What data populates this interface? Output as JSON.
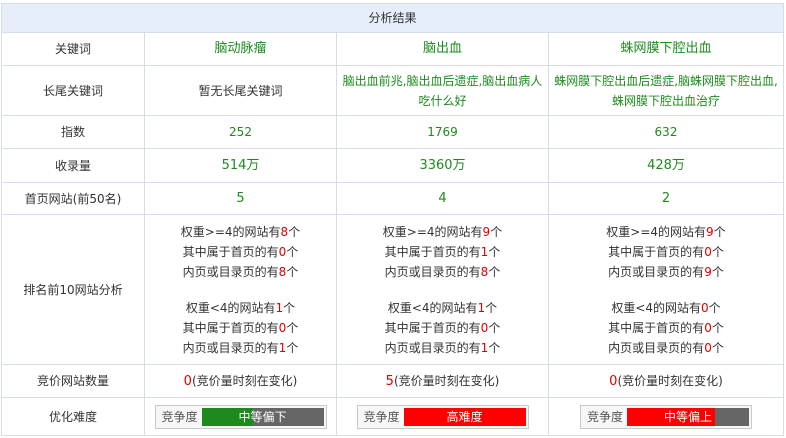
{
  "title": "分析结果",
  "rows": {
    "keyword": {
      "label": "关键词",
      "values": [
        "脑动脉瘤",
        "脑出血",
        "蛛网膜下腔出血"
      ]
    },
    "longtail": {
      "label": "长尾关键词",
      "values": [
        "暂无长尾关键词",
        "脑出血前兆,脑出血后遗症,脑出血病人吃什么好",
        "蛛网膜下腔出血后遗症,脑蛛网膜下腔出血,蛛网膜下腔出血治疗"
      ]
    },
    "index": {
      "label": "指数",
      "values": [
        "252",
        "1769",
        "632"
      ]
    },
    "indexed": {
      "label": "收录量",
      "values": [
        "514万",
        "3360万",
        "428万"
      ]
    },
    "homepage": {
      "label": "首页网站(前50名)",
      "values": [
        "5",
        "4",
        "2"
      ]
    },
    "top10": {
      "label": "排名前10网站分析",
      "cols": [
        {
          "hi": {
            "total_pre": "权重>=4的网站有",
            "total": "8",
            "home_pre": "其中属于首页的有",
            "home": "0",
            "inner_pre": "内页或目录页的有",
            "inner": "8",
            "unit": "个"
          },
          "lo": {
            "total_pre": "权重<4的网站有",
            "total": "1",
            "home_pre": "其中属于首页的有",
            "home": "0",
            "inner_pre": "内页或目录页的有",
            "inner": "1",
            "unit": "个"
          }
        },
        {
          "hi": {
            "total_pre": "权重>=4的网站有",
            "total": "9",
            "home_pre": "其中属于首页的有",
            "home": "1",
            "inner_pre": "内页或目录页的有",
            "inner": "8",
            "unit": "个"
          },
          "lo": {
            "total_pre": "权重<4的网站有",
            "total": "1",
            "home_pre": "其中属于首页的有",
            "home": "0",
            "inner_pre": "内页或目录页的有",
            "inner": "1",
            "unit": "个"
          }
        },
        {
          "hi": {
            "total_pre": "权重>=4的网站有",
            "total": "9",
            "home_pre": "其中属于首页的有",
            "home": "0",
            "inner_pre": "内页或目录页的有",
            "inner": "9",
            "unit": "个"
          },
          "lo": {
            "total_pre": "权重<4的网站有",
            "total": "0",
            "home_pre": "其中属于首页的有",
            "home": "0",
            "inner_pre": "内页或目录页的有",
            "inner": "0",
            "unit": "个"
          }
        }
      ]
    },
    "bidding": {
      "label": "竞价网站数量",
      "suffix": "(竞价量时刻在变化)",
      "values": [
        "0",
        "5",
        "0"
      ]
    },
    "difficulty": {
      "label": "优化难度",
      "meter_label": "竞争度",
      "items": [
        {
          "text": "中等偏下",
          "level": 0.42,
          "color": "#1e8a1e"
        },
        {
          "text": "高难度",
          "level": 1.0,
          "color": "#ff0000"
        },
        {
          "text": "中等偏上",
          "level": 0.72,
          "color": "#ff0000"
        }
      ]
    }
  },
  "colors": {
    "header_bg": "#e5eefa",
    "border": "#d7dde6",
    "green": "#1e8a1e",
    "red": "#e00000",
    "meter_track": "#666666"
  }
}
